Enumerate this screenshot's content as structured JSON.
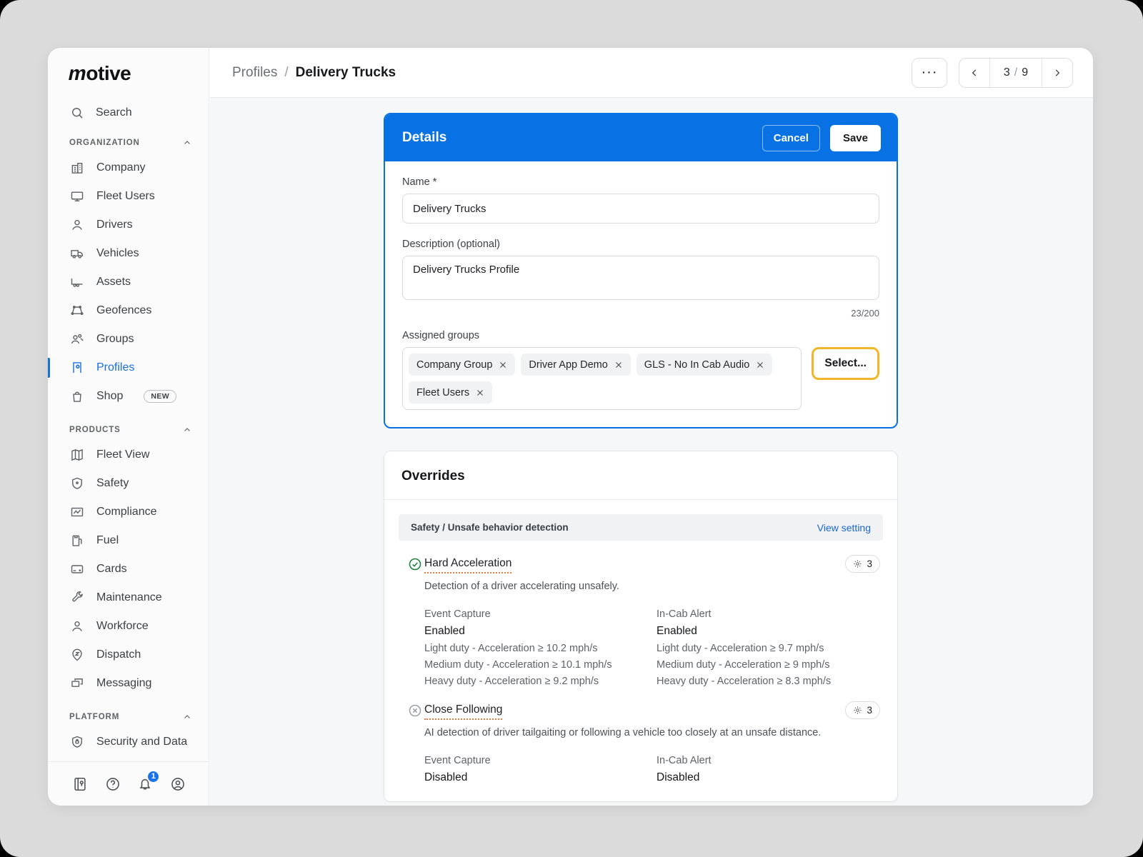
{
  "sidebar": {
    "logo": "motive",
    "search_label": "Search",
    "sections": [
      {
        "label": "ORGANIZATION",
        "items": [
          {
            "label": "Company"
          },
          {
            "label": "Fleet Users"
          },
          {
            "label": "Drivers"
          },
          {
            "label": "Vehicles"
          },
          {
            "label": "Assets"
          },
          {
            "label": "Geofences"
          },
          {
            "label": "Groups"
          },
          {
            "label": "Profiles",
            "active": true
          },
          {
            "label": "Shop",
            "badge": "NEW"
          }
        ]
      },
      {
        "label": "PRODUCTS",
        "items": [
          {
            "label": "Fleet View"
          },
          {
            "label": "Safety"
          },
          {
            "label": "Compliance"
          },
          {
            "label": "Fuel"
          },
          {
            "label": "Cards"
          },
          {
            "label": "Maintenance"
          },
          {
            "label": "Workforce"
          },
          {
            "label": "Dispatch"
          },
          {
            "label": "Messaging"
          }
        ]
      },
      {
        "label": "PLATFORM",
        "items": [
          {
            "label": "Security and Data"
          }
        ]
      }
    ],
    "footer": {
      "notification_count": "1"
    }
  },
  "header": {
    "breadcrumb_parent": "Profiles",
    "breadcrumb_separator": "/",
    "breadcrumb_current": "Delivery Trucks",
    "more_icon": "···",
    "pagination": {
      "current": "3",
      "separator": "/",
      "total": "9"
    }
  },
  "details": {
    "title": "Details",
    "cancel_label": "Cancel",
    "save_label": "Save",
    "name_label": "Name *",
    "name_value": "Delivery Trucks",
    "description_label": "Description (optional)",
    "description_value": "Delivery Trucks Profile",
    "char_counter": "23/200",
    "assigned_groups_label": "Assigned groups",
    "groups": [
      "Company Group",
      "Driver App Demo",
      "GLS - No In Cab Audio",
      "Fleet Users"
    ],
    "select_label": "Select..."
  },
  "overrides": {
    "title": "Overrides",
    "section_header": "Safety / Unsafe behavior detection",
    "view_setting_label": "View setting",
    "items": [
      {
        "title": "Hard Acceleration",
        "status": "enabled",
        "badge_count": "3",
        "description": "Detection of a driver accelerating unsafely.",
        "event_capture_label": "Event Capture",
        "event_capture_value": "Enabled",
        "event_capture_details": [
          "Light duty - Acceleration ≥ 10.2 mph/s",
          "Medium duty - Acceleration ≥ 10.1 mph/s",
          "Heavy duty - Acceleration ≥ 9.2 mph/s"
        ],
        "incab_label": "In-Cab Alert",
        "incab_value": "Enabled",
        "incab_details": [
          "Light duty - Acceleration ≥ 9.7 mph/s",
          "Medium duty - Acceleration ≥ 9 mph/s",
          "Heavy duty - Acceleration ≥ 8.3 mph/s"
        ]
      },
      {
        "title": "Close Following",
        "status": "disabled",
        "badge_count": "3",
        "description": "AI detection of driver tailgaiting or following a vehicle too closely at an unsafe distance.",
        "event_capture_label": "Event Capture",
        "event_capture_value": "Disabled",
        "incab_label": "In-Cab Alert",
        "incab_value": "Disabled"
      }
    ]
  },
  "colors": {
    "primary_blue": "#0872e4",
    "active_nav_blue": "#1a6fe0",
    "link_blue": "#1967d2",
    "select_border_orange": "#f2b62b",
    "dotted_underline_orange": "#f0793a",
    "enabled_green": "#188038",
    "disabled_gray": "#9aa0a6",
    "surround_gray": "#dbdbdb"
  }
}
